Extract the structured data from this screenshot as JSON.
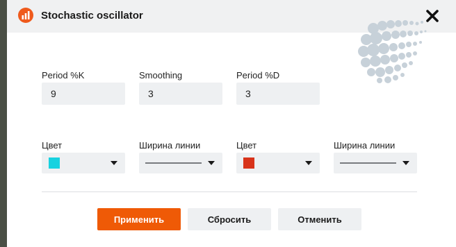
{
  "dialog": {
    "title": "Stochastic oscillator",
    "app_icon": "bar-chart-icon",
    "close_icon": "close-icon",
    "watermark_icon": "globe-logo-icon"
  },
  "params": [
    {
      "label": "Period %K",
      "value": "9"
    },
    {
      "label": "Smoothing",
      "value": "3"
    },
    {
      "label": "Period %D",
      "value": "3"
    }
  ],
  "styles": [
    {
      "label": "Цвет",
      "kind": "color",
      "color": "#18d2e0"
    },
    {
      "label": "Ширина линии",
      "kind": "line-width"
    },
    {
      "label": "Цвет",
      "kind": "color",
      "color": "#d8331a"
    },
    {
      "label": "Ширина линии",
      "kind": "line-width"
    }
  ],
  "buttons": {
    "apply": "Применить",
    "reset": "Сбросить",
    "cancel": "Отменить"
  },
  "colors": {
    "accent": "#ef5a06",
    "field_bg": "#eef0f2",
    "header_bg": "#f0f1f2"
  }
}
